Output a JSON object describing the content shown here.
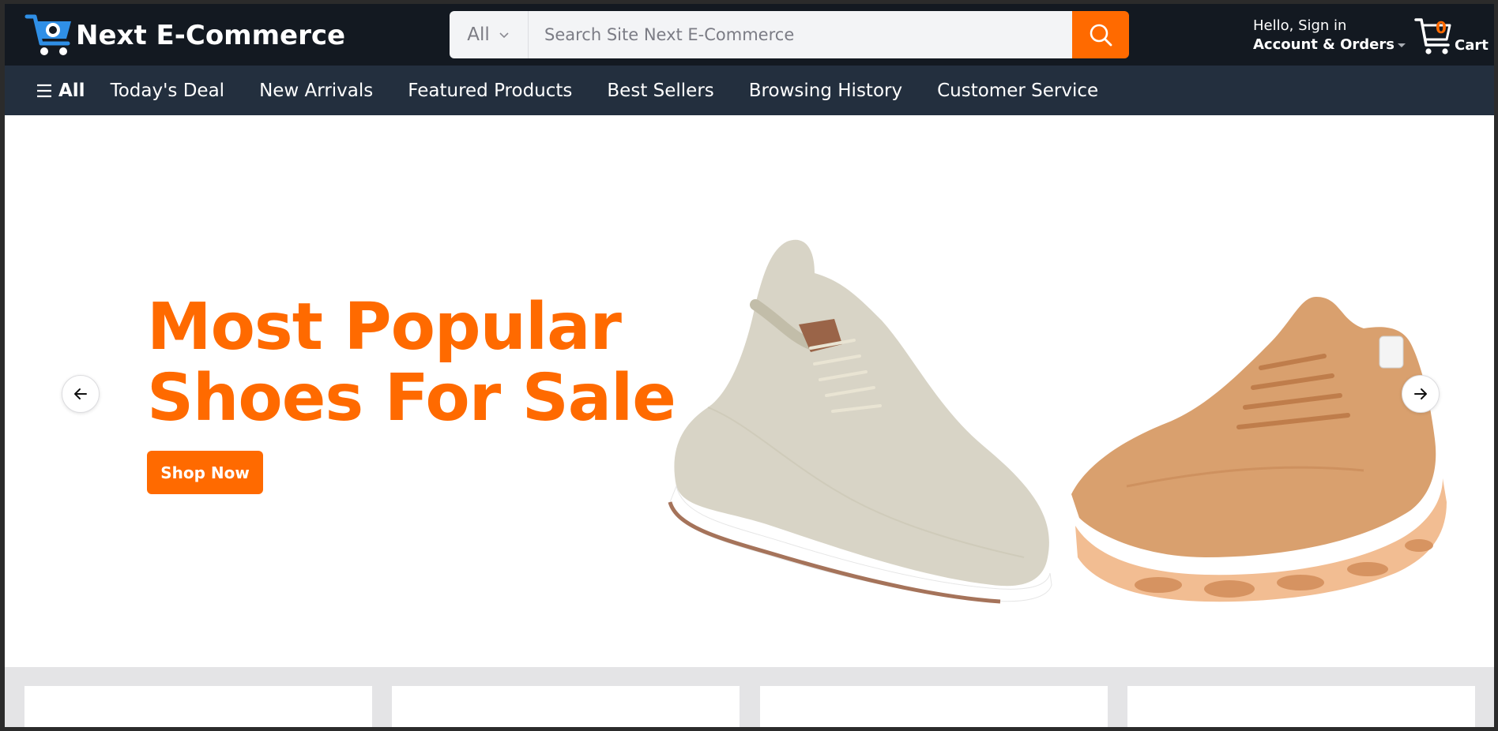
{
  "header": {
    "brand": "Next E-Commerce",
    "search": {
      "category": "All",
      "placeholder": "Search Site Next E-Commerce"
    },
    "account": {
      "greeting": "Hello, Sign in",
      "label": "Account & Orders"
    },
    "cart": {
      "count": "0",
      "label": "Cart"
    }
  },
  "nav": {
    "all_label": "All",
    "items": [
      {
        "label": "Today's Deal"
      },
      {
        "label": "New Arrivals"
      },
      {
        "label": "Featured Products"
      },
      {
        "label": "Best Sellers"
      },
      {
        "label": "Browsing History"
      },
      {
        "label": "Customer Service"
      }
    ]
  },
  "hero": {
    "title_line1": "Most Popular",
    "title_line2": "Shoes For Sale",
    "cta": "Shop Now"
  },
  "colors": {
    "accent": "#ff6a00",
    "topbar": "#131921",
    "navbar": "#232f3e"
  },
  "icons": [
    "cart-logo-icon",
    "chevron-down-icon",
    "search-icon",
    "caret-down-icon",
    "cart-icon",
    "hamburger-icon",
    "arrow-left-icon",
    "arrow-right-icon"
  ]
}
